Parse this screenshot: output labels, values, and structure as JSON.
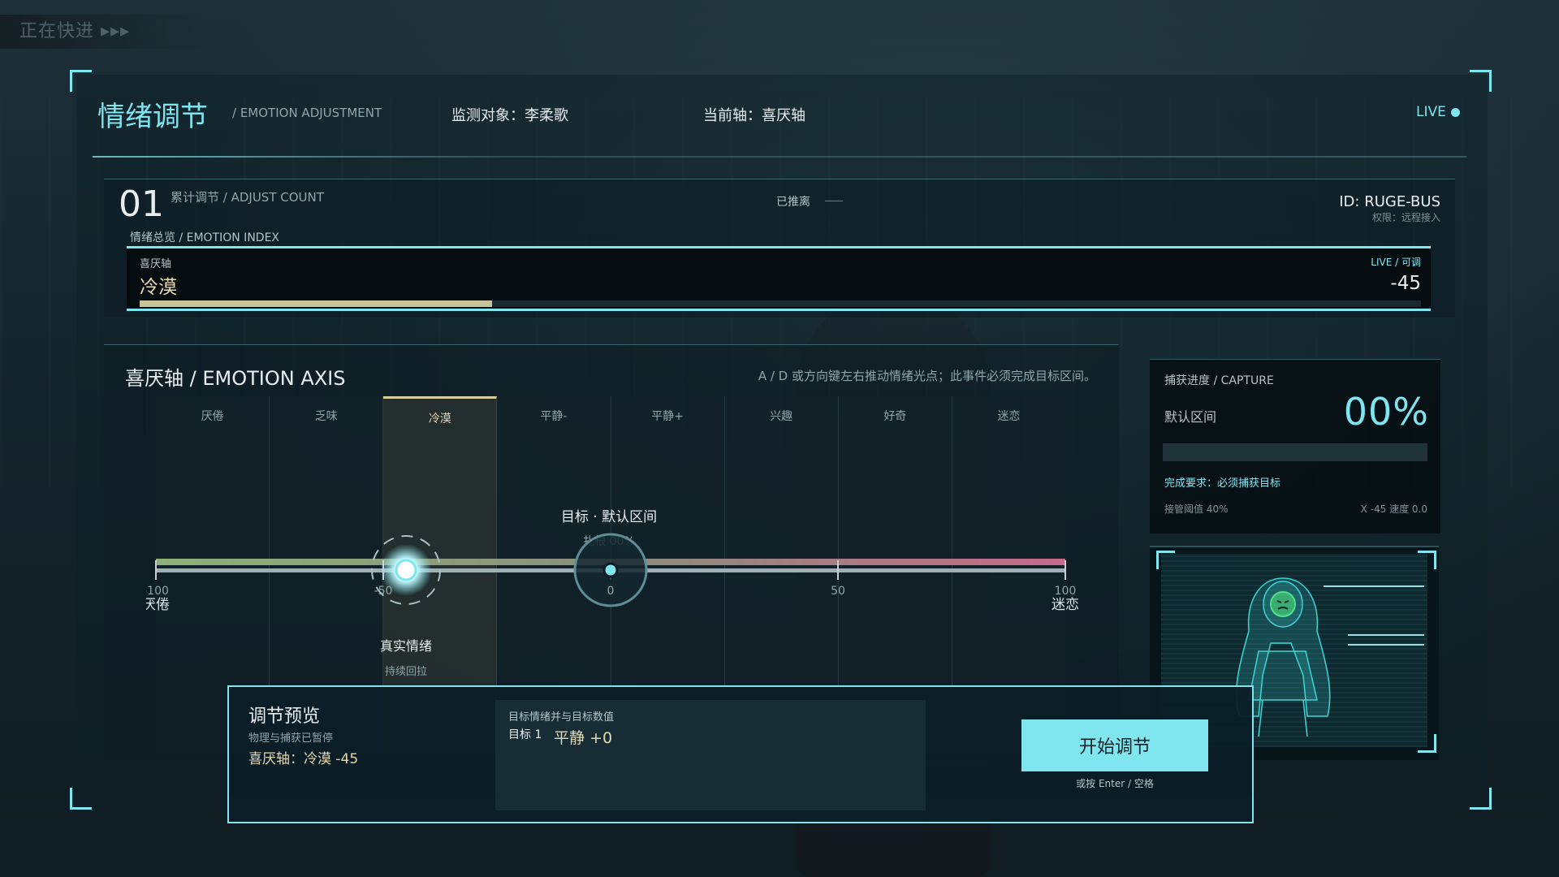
{
  "fast_forward": "正在快进 ▸▸▸",
  "header": {
    "title": "情绪调节",
    "subtitle": "/ EMOTION ADJUSTMENT",
    "monitor": "监测对象：李柔歌",
    "current_axis": "当前轴：喜厌轴",
    "live": "LIVE"
  },
  "count_panel": {
    "count": "01",
    "count_label": "累计调节 / ADJUST COUNT",
    "pushed_label": "已推离",
    "id": "ID: RUGE-BUS",
    "permission": "权限：远程接入"
  },
  "emotion_index": {
    "label": "情绪总览 / EMOTION INDEX",
    "axis_name": "喜厌轴",
    "state": "冷漠",
    "live_tag": "LIVE / 可调",
    "value": "-45",
    "fill_fraction": 0.275
  },
  "axis": {
    "title": "喜厌轴 / EMOTION AXIS",
    "hint": "A / D 或方向键左右推动情绪光点；此事件必须完成目标区间。",
    "segments": [
      "厌倦",
      "乏味",
      "冷漠",
      "平静-",
      "平静+",
      "兴趣",
      "好奇",
      "迷恋"
    ],
    "active_segment": 2,
    "ticks": [
      {
        "value": -100,
        "label": "-100",
        "name": "厌倦"
      },
      {
        "value": -50,
        "label": "-50",
        "name": ""
      },
      {
        "value": 0,
        "label": "0",
        "name": ""
      },
      {
        "value": 50,
        "label": "50",
        "name": ""
      },
      {
        "value": 100,
        "label": "100",
        "name": "迷恋"
      }
    ],
    "min": -100,
    "max": 100,
    "true_value": -45,
    "target_value": 0,
    "target_title": "目标 · 默认区间",
    "target_sub": "扎根 00%",
    "true_label": "真实情绪",
    "true_sub": "持续回拉"
  },
  "capture": {
    "title": "捕获进度 / CAPTURE",
    "default_zone": "默认区间",
    "percent": "00%",
    "fill_fraction": 0,
    "requirement": "完成要求：必须捕获目标",
    "threshold": "接管阈值 40%",
    "xy": "X -45   速度 0.0"
  },
  "preview": {
    "title": "调节预览",
    "subtitle": "物理与捕获已暂停",
    "axis_value": "喜厌轴：冷漠 -45",
    "target_head": "目标情绪并与目标数值",
    "target_label": "目标 1",
    "target_value": "平静 +0",
    "button": "开始调节",
    "hint": "或按 Enter / 空格"
  },
  "colors": {
    "accent": "#7fe5ef",
    "warm": "#e8d8b0",
    "gradient_left": "#8fb07a",
    "gradient_right": "#c66a8a"
  }
}
